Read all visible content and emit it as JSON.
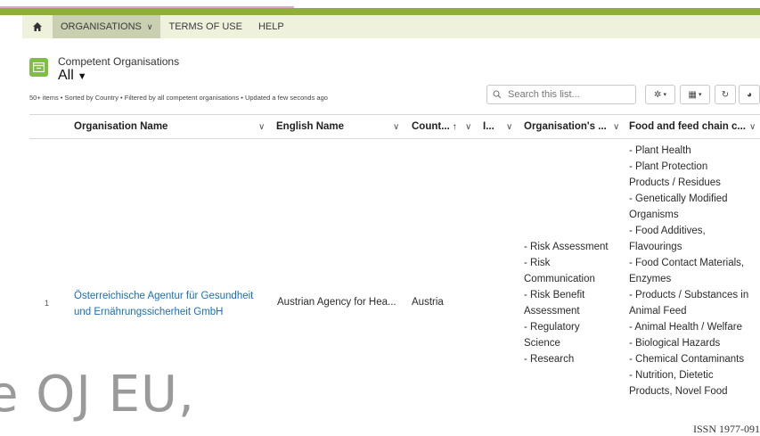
{
  "nav": {
    "items": [
      {
        "label": "ORGANISATIONS",
        "active": true
      },
      {
        "label": "TERMS OF USE",
        "active": false
      },
      {
        "label": "HELP",
        "active": false
      }
    ]
  },
  "list": {
    "object_name": "Competent Organisations",
    "view_name": "All",
    "meta": "50+ items • Sorted by Country • Filtered by all competent organisations • Updated a few seconds ago"
  },
  "search": {
    "placeholder": "Search this list..."
  },
  "columns": [
    {
      "label": "Organisation Name"
    },
    {
      "label": "English Name"
    },
    {
      "label": "Count..."
    },
    {
      "label": "I..."
    },
    {
      "label": "Organisation's ..."
    },
    {
      "label": "Food and feed chain c..."
    }
  ],
  "rows": [
    {
      "index": "1",
      "org_name_line1": "Österreichische Agentur für Gesundheit",
      "org_name_line2": "und Ernährungssicherheit GmbH",
      "english_name": "Austrian Agency for Hea...",
      "country": "Austria",
      "activities": [
        "- Risk Assessment",
        "- Risk",
        "Communication",
        "- Risk Benefit",
        "Assessment",
        "- Regulatory",
        "Science",
        "- Research"
      ],
      "food_chain": [
        "- Plant Health",
        "- Plant Protection",
        "Products / Residues",
        "- Genetically Modified",
        "Organisms",
        "- Food Additives,",
        "Flavourings",
        "- Food Contact Materials,",
        "Enzymes",
        "- Products / Substances in",
        "Animal Feed",
        "- Animal Health / Welfare",
        "- Biological Hazards",
        "- Chemical Contaminants",
        "- Nutrition, Dietetic",
        "Products, Novel Food"
      ]
    }
  ],
  "overlay": {
    "text": "e OJ EU,",
    "issn": "ISSN 1977-091"
  },
  "colors": {
    "brand_green": "#8fae3b",
    "nav_bg": "#eef2dc",
    "link": "#1a6fb5",
    "icon_green": "#7fbf3f"
  }
}
